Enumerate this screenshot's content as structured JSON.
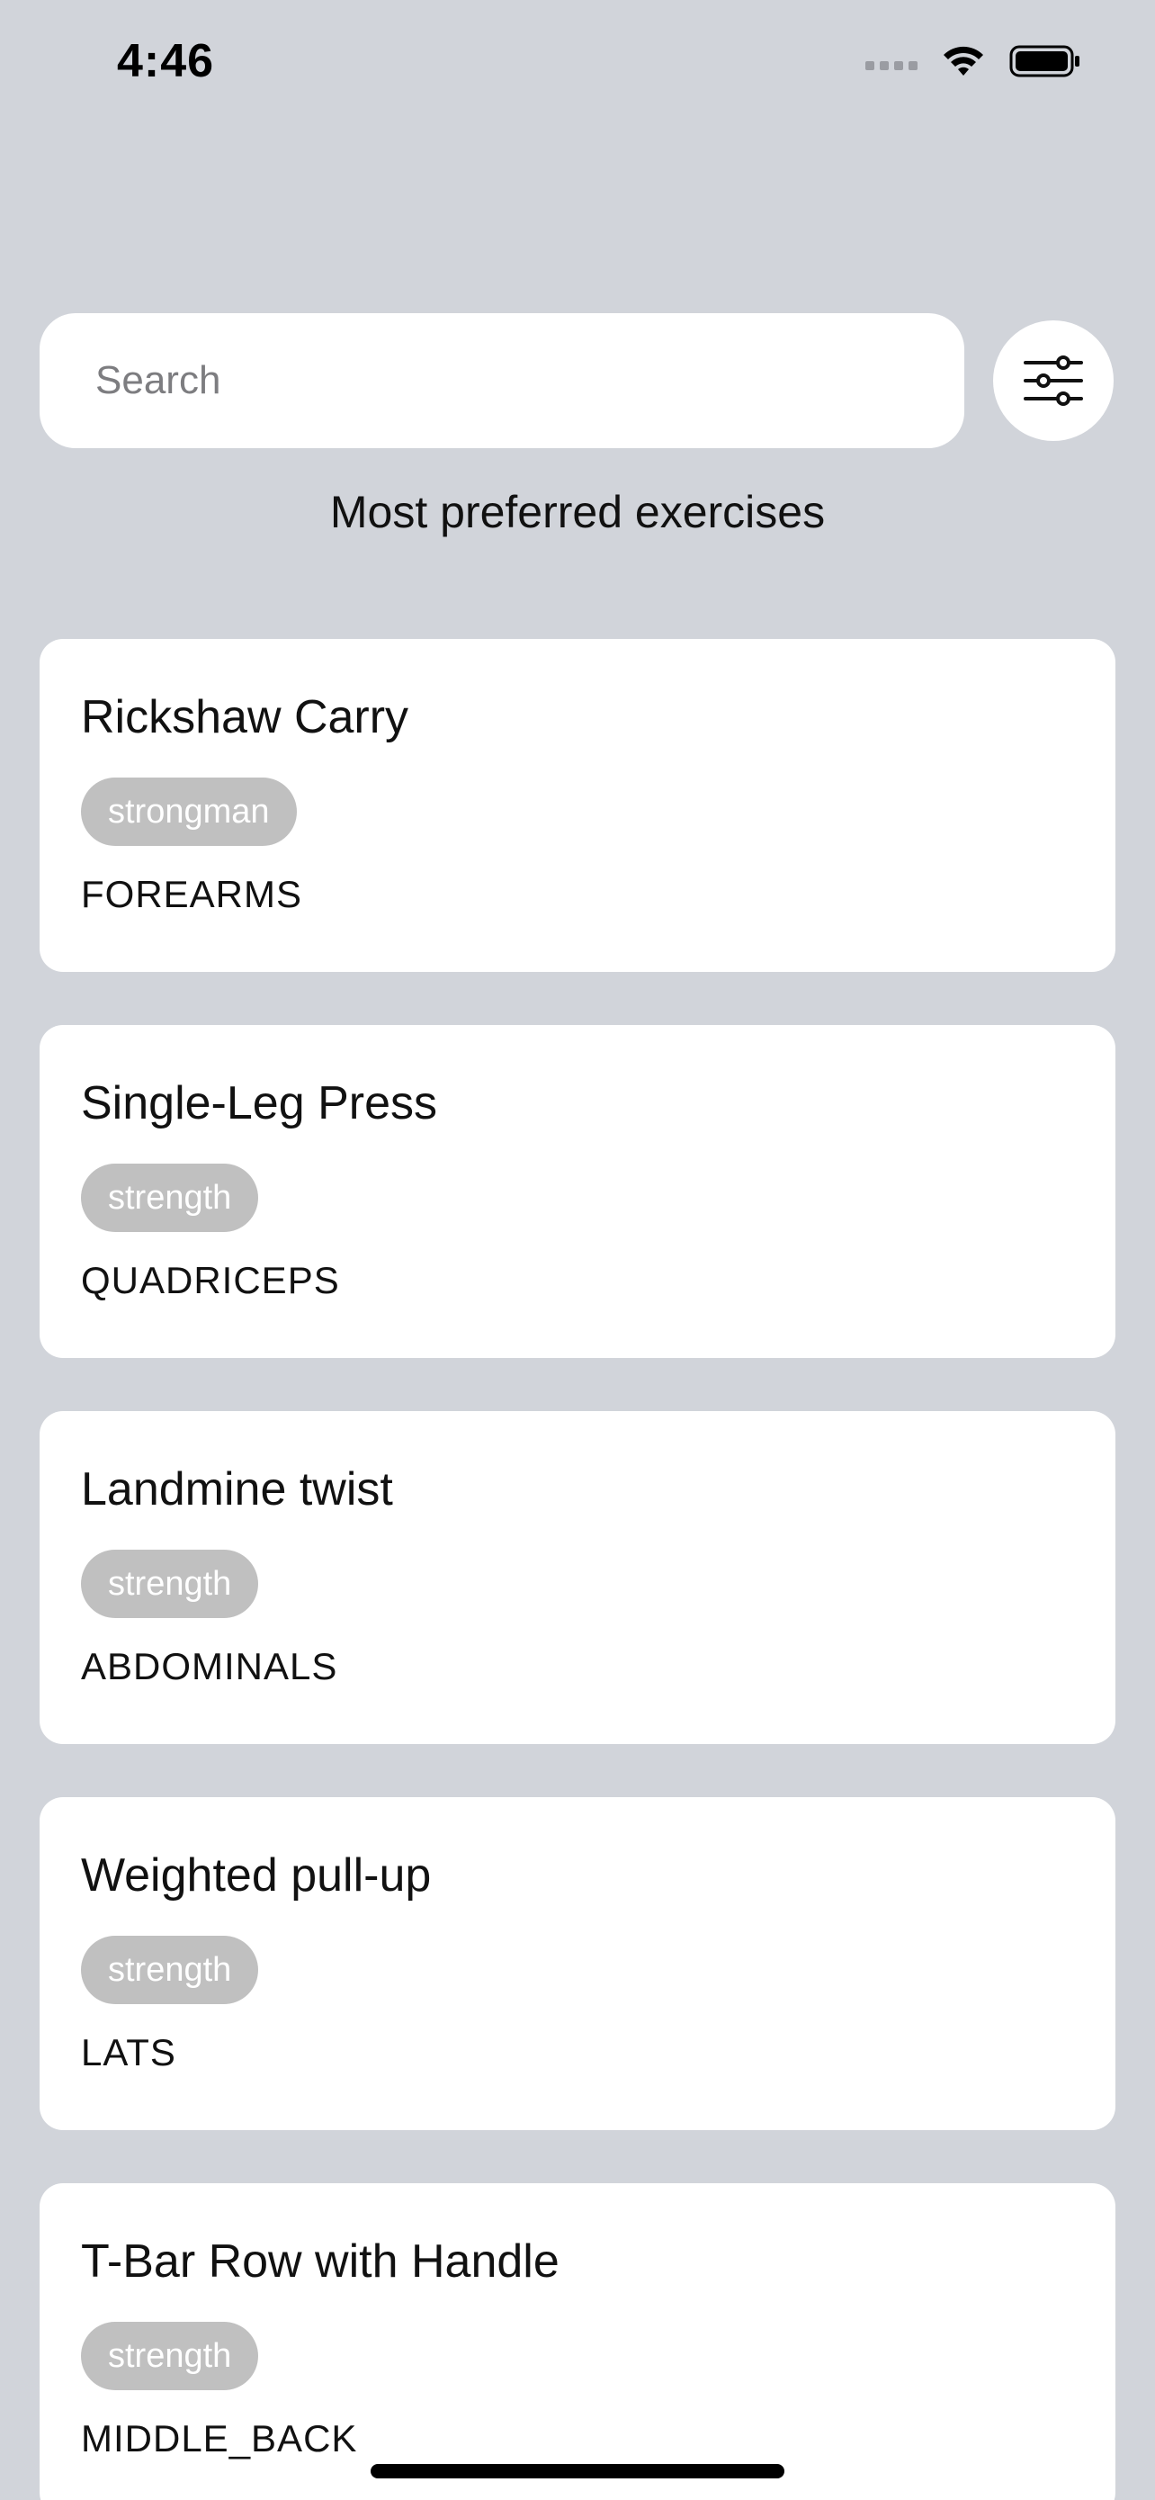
{
  "status_bar": {
    "time": "4:46"
  },
  "search": {
    "placeholder": "Search",
    "value": ""
  },
  "filter_button": {
    "icon": "sliders-icon"
  },
  "section_title": "Most preferred exercises",
  "exercises": [
    {
      "name": "Rickshaw Carry",
      "category": "strongman",
      "muscle": "FOREARMS"
    },
    {
      "name": "Single-Leg Press",
      "category": "strength",
      "muscle": "QUADRICEPS"
    },
    {
      "name": "Landmine twist",
      "category": "strength",
      "muscle": "ABDOMINALS"
    },
    {
      "name": "Weighted pull-up",
      "category": "strength",
      "muscle": "LATS"
    },
    {
      "name": "T-Bar Row with Handle",
      "category": "strength",
      "muscle": "MIDDLE_BACK"
    }
  ],
  "colors": {
    "background": "#d1d4da",
    "card": "#ffffff",
    "tag_background": "#c0c0c0",
    "tag_text": "#ffffff"
  }
}
